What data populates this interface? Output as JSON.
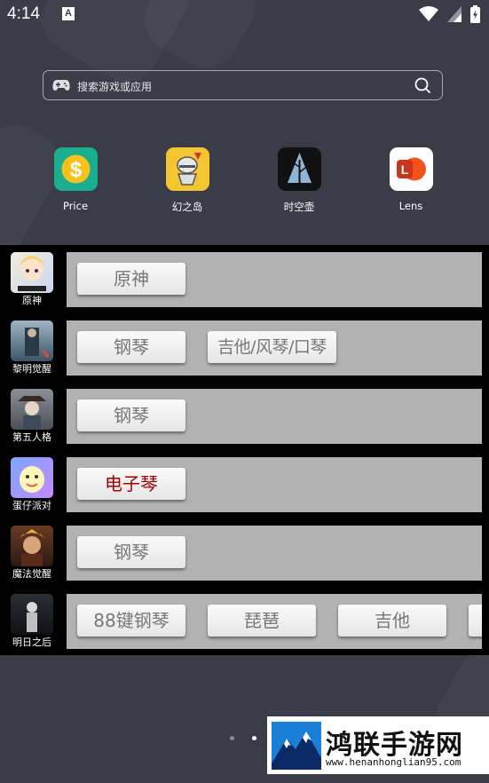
{
  "status_bar": {
    "time": "4:14",
    "a_badge": "A"
  },
  "search": {
    "placeholder": "搜索游戏或应用"
  },
  "apps": [
    {
      "label": "Price",
      "icon": "dollar-icon",
      "color": "#1aae8f"
    },
    {
      "label": "幻之岛",
      "icon": "knight-icon",
      "color": "#f2c531"
    },
    {
      "label": "时空壶",
      "icon": "tree-icon",
      "color": "#111111"
    },
    {
      "label": "Lens",
      "icon": "lens-icon",
      "color": "#f4511e"
    }
  ],
  "games": [
    {
      "name": "原神",
      "instruments": [
        {
          "label": "原神",
          "active": false
        }
      ]
    },
    {
      "name": "黎明觉醒",
      "instruments": [
        {
          "label": "钢琴",
          "active": false
        },
        {
          "label": "吉他/风琴/口琴",
          "active": false
        }
      ]
    },
    {
      "name": "第五人格",
      "instruments": [
        {
          "label": "钢琴",
          "active": false
        }
      ]
    },
    {
      "name": "蛋仔派对",
      "instruments": [
        {
          "label": "电子琴",
          "active": true
        }
      ]
    },
    {
      "name": "魔法觉醒",
      "instruments": [
        {
          "label": "钢琴",
          "active": false
        }
      ]
    },
    {
      "name": "明日之后",
      "instruments": [
        {
          "label": "88键钢琴",
          "active": false
        },
        {
          "label": "琵琶",
          "active": false
        },
        {
          "label": "吉他",
          "active": false
        }
      ]
    }
  ],
  "colors": {
    "active_instrument": "#a50000",
    "inactive_instrument": "#777777",
    "bar": "#b2b2b2"
  },
  "watermark": {
    "name": "鸿联手游网",
    "url": "www.henanhonglian95.com"
  }
}
